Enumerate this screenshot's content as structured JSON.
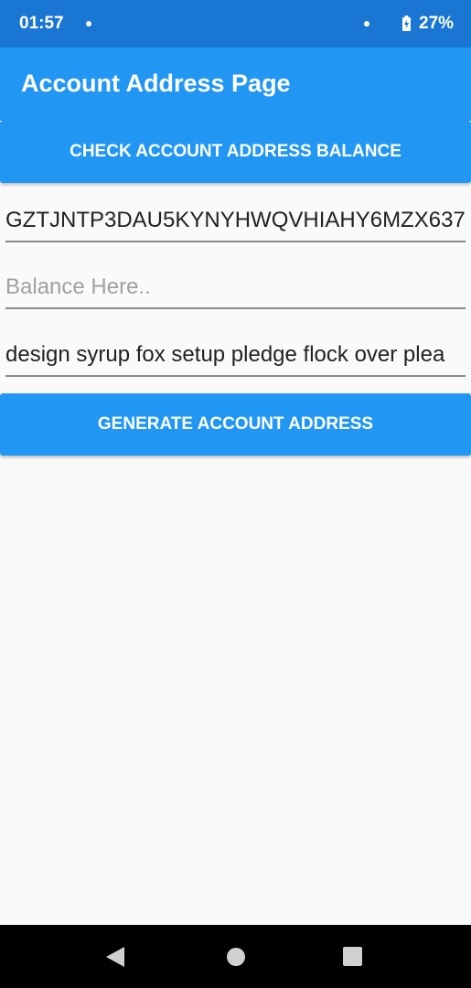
{
  "status_bar": {
    "time": "01:57",
    "battery": "27%",
    "battery_icon": "battery-charging-icon"
  },
  "app_bar": {
    "title": "Account Address Page"
  },
  "check_button": {
    "label": "CHECK ACCOUNT ADDRESS BALANCE"
  },
  "address_field": {
    "value": "GZTJNTP3DAU5KYNYHWQVHIAHY6MZX637"
  },
  "balance_field": {
    "value": "",
    "placeholder": "Balance Here.."
  },
  "mnemonic_field": {
    "value": "design syrup fox setup pledge flock over plea"
  },
  "generate_button": {
    "label": "GENERATE ACCOUNT ADDRESS"
  },
  "nav_bar": {
    "back_icon": "back-triangle-icon",
    "home_icon": "home-circle-icon",
    "recents_icon": "recents-square-icon"
  },
  "colors": {
    "status_bar": "#1976d2",
    "primary": "#2196f3",
    "background": "#fafafa"
  }
}
